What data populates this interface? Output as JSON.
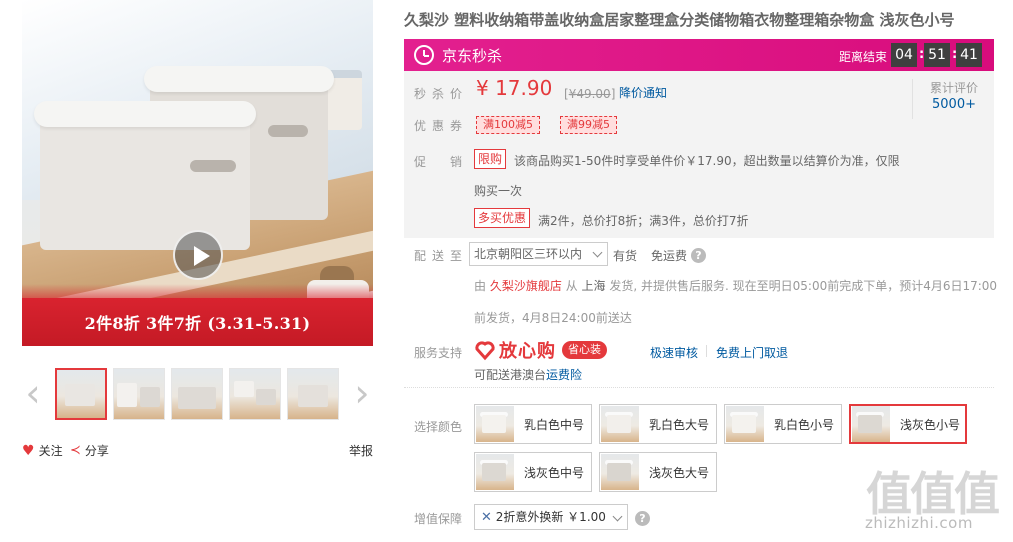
{
  "gallery": {
    "promo_banner": "2件8折 3件7折 (3.31-5.31)",
    "thumb_count": 5,
    "follow_label": "关注",
    "share_label": "分享",
    "report_label": "举报"
  },
  "product": {
    "title": "久梨沙 塑料收纳箱带盖收纳盒居家整理盒分类储物箱衣物整理箱杂物盒 浅灰色小号"
  },
  "flash_sale": {
    "label": "京东秒杀",
    "countdown_label": "距离结束",
    "hours": "04",
    "minutes": "51",
    "seconds": "41",
    "color": "#d80c7c"
  },
  "price": {
    "label": "秒杀价",
    "value": "¥ 17.90",
    "original": "¥49.00",
    "notify": "降价通知",
    "reviews_label": "累计评价",
    "reviews_count": "5000+"
  },
  "coupons": {
    "label": "优惠券",
    "items": [
      "满100减5",
      "满99减5"
    ]
  },
  "promotion": {
    "label": "促销",
    "tag1": "限购",
    "text1_line1": "该商品购买1-50件时享受单件价￥17.90，超出数量以结算价为准，仅限",
    "text1_line2": "购买一次",
    "tag2": "多买优惠",
    "text2": "满2件，总价打8折；满3件，总价打7折"
  },
  "delivery": {
    "label": "配送至",
    "address": "北京朝阳区三环以内",
    "stock": "有货",
    "free_shipping": "免运费",
    "help_icon": "?",
    "line1_prefix": "由",
    "store": "久梨沙旗舰店",
    "line1_from": "从",
    "city": "上海",
    "line1_rest": "发货, 并提供售后服务. 现在至明日05:00前完成下单，预计4月6日17:00",
    "line2": "前发货，4月8日24:00前送达"
  },
  "service": {
    "label": "服务支持",
    "brand": "放心购",
    "badge": "省心装",
    "link1": "极速审核",
    "link2": "免费上门取退",
    "hk_prefix": "可配送港澳台",
    "hk_link": "运费险"
  },
  "colors": {
    "label": "选择颜色",
    "selected": "浅灰色小号",
    "options": [
      "乳白色中号",
      "乳白色大号",
      "乳白色小号",
      "浅灰色小号",
      "浅灰色中号",
      "浅灰色大号"
    ]
  },
  "warranty": {
    "label": "增值保障",
    "option": "2折意外换新 ￥1.00",
    "help_icon": "?"
  },
  "watermark": {
    "big": "值值值",
    "url": "zhizhizhi.com"
  },
  "accent_color": "#e4393c"
}
